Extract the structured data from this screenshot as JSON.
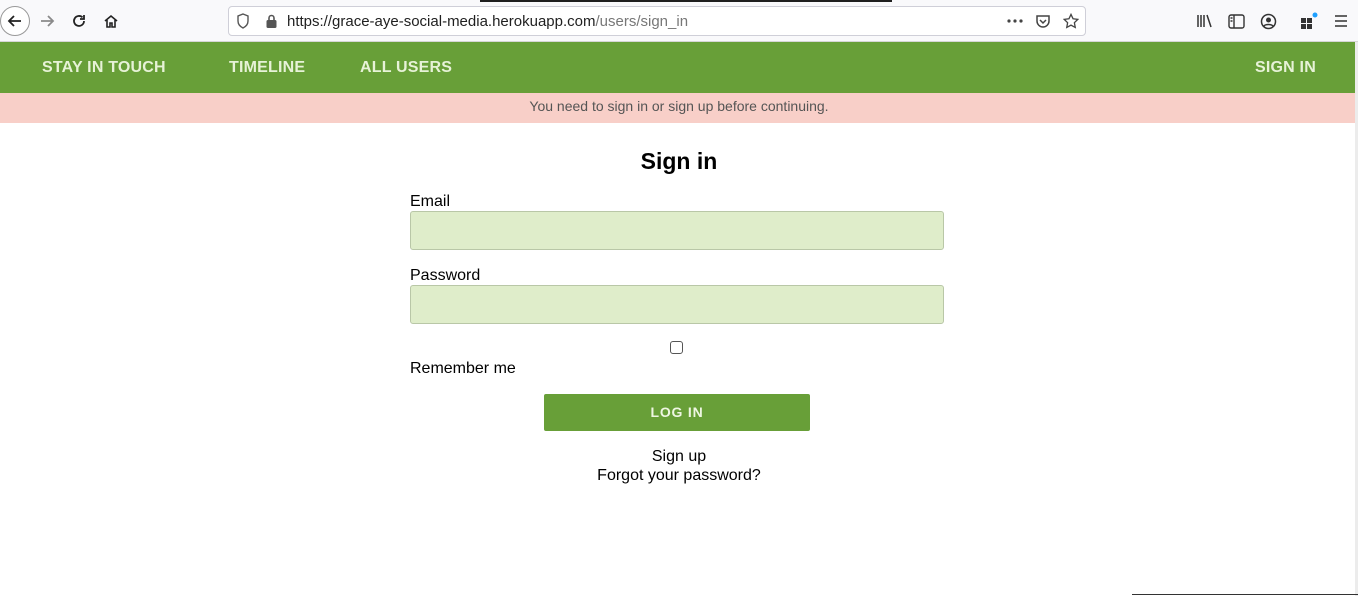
{
  "browser": {
    "url_host": "https://grace-aye-social-media.herokuapp.com",
    "url_path": "/users/sign_in",
    "icons": {
      "back": "back-arrow-icon",
      "forward": "forward-arrow-icon",
      "reload": "reload-icon",
      "home": "home-icon",
      "tracking": "shield-icon",
      "lock": "lock-icon",
      "more": "more-dots-icon",
      "pocket": "pocket-icon",
      "bookmark": "star-icon",
      "library": "library-icon",
      "sidebar": "sidebar-icon",
      "account": "account-icon",
      "extensions": "extensions-icon",
      "menu": "hamburger-menu-icon"
    }
  },
  "nav": {
    "brand": "STAY IN TOUCH",
    "timeline": "TIMELINE",
    "all_users": "ALL USERS",
    "sign_in": "SIGN IN"
  },
  "flash": {
    "message": "You need to sign in or sign up before continuing."
  },
  "form": {
    "title": "Sign in",
    "email_label": "Email",
    "email_value": "",
    "password_label": "Password",
    "password_value": "",
    "remember_label": "Remember me",
    "remember_checked": false,
    "submit_label": "LOG IN"
  },
  "links": {
    "sign_up": "Sign up",
    "forgot_password": "Forgot your password?"
  },
  "colors": {
    "nav_bg": "#689f38",
    "nav_text": "#e7f2d7",
    "flash_bg": "#f8cfc8",
    "input_bg": "#dfedca",
    "button_bg": "#689f38"
  }
}
